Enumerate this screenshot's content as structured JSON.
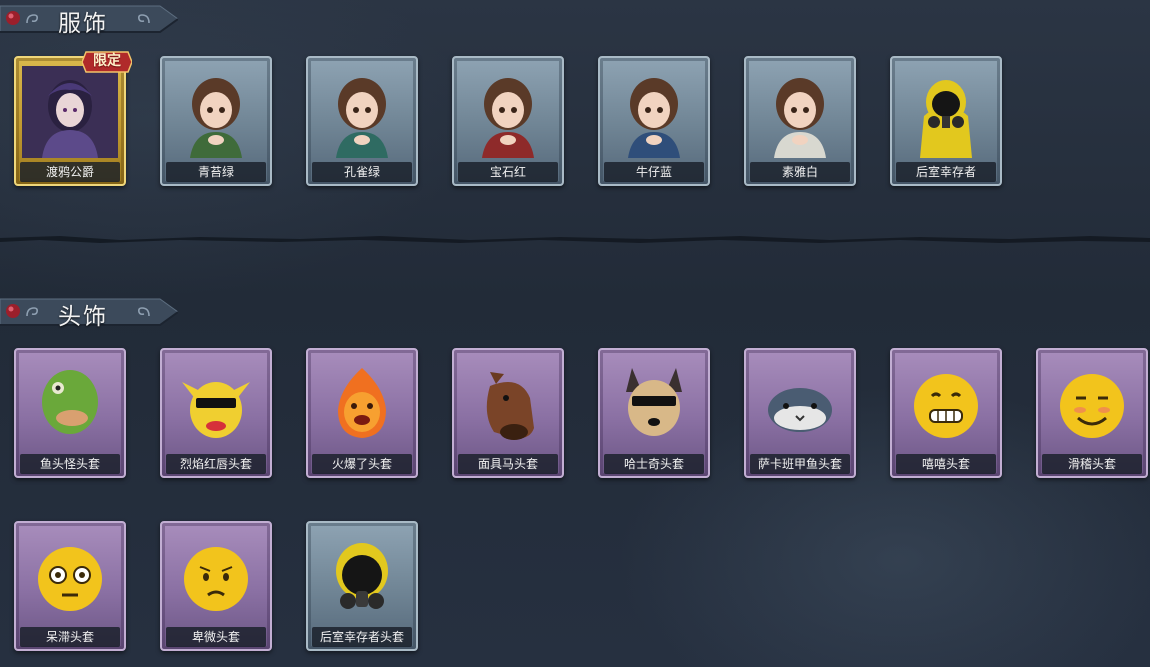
{
  "sections": {
    "costumes": {
      "title": "服饰",
      "items": [
        {
          "label": "渡鸦公爵",
          "rarity": "gold",
          "badge": "限定"
        },
        {
          "label": "青苔绿",
          "rarity": "blue"
        },
        {
          "label": "孔雀绿",
          "rarity": "blue"
        },
        {
          "label": "宝石红",
          "rarity": "blue"
        },
        {
          "label": "牛仔蓝",
          "rarity": "blue"
        },
        {
          "label": "素雅白",
          "rarity": "blue"
        },
        {
          "label": "后室幸存者",
          "rarity": "blue"
        }
      ]
    },
    "headwear": {
      "title": "头饰",
      "items": [
        {
          "label": "鱼头怪头套",
          "rarity": "purple"
        },
        {
          "label": "烈焰红唇头套",
          "rarity": "purple"
        },
        {
          "label": "火爆了头套",
          "rarity": "purple"
        },
        {
          "label": "面具马头套",
          "rarity": "purple"
        },
        {
          "label": "哈士奇头套",
          "rarity": "purple"
        },
        {
          "label": "萨卡班甲鱼头套",
          "rarity": "purple"
        },
        {
          "label": "嘻嘻头套",
          "rarity": "purple"
        },
        {
          "label": "滑稽头套",
          "rarity": "purple"
        },
        {
          "label": "呆滞头套",
          "rarity": "purple"
        },
        {
          "label": "卑微头套",
          "rarity": "purple"
        },
        {
          "label": "后室幸存者头套",
          "rarity": "blue"
        }
      ]
    }
  },
  "colors": {
    "background": "#273140",
    "rarity_blue": "#7d92a3",
    "rarity_purple": "#9a80b3",
    "rarity_gold": "#c9a43a",
    "badge_red": "#b02a2a"
  },
  "icons": {
    "header_ornament": "red-gem-icon",
    "header_swirl": "swirl-ornament-icon"
  }
}
